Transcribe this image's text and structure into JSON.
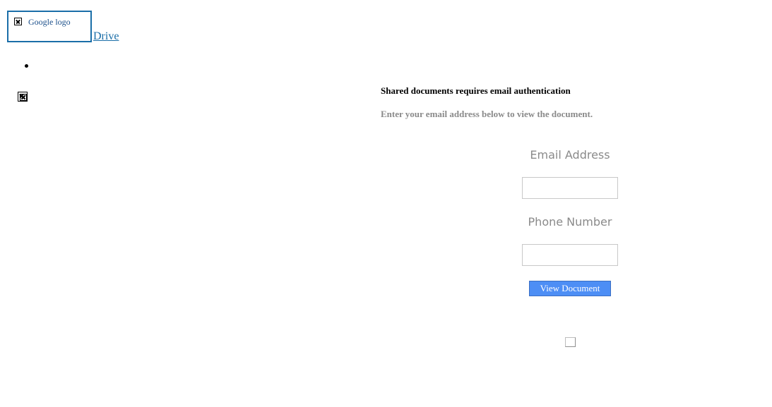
{
  "header": {
    "logo_alt": "Google logo",
    "drive_label": "Drive"
  },
  "main": {
    "heading": "Shared documents requires email authentication",
    "subheading": "Enter your email address below to view the document.",
    "email_label": "Email Address",
    "email_value": "",
    "phone_label": "Phone Number",
    "phone_value": "",
    "submit_label": "View Document",
    "checkbox_checked": false
  },
  "colors": {
    "link": "#1a6ea8",
    "button": "#4d8ef5",
    "muted_text": "#8a8a8a"
  },
  "icons": [
    "broken-image-icon",
    "broken-image-icon"
  ]
}
